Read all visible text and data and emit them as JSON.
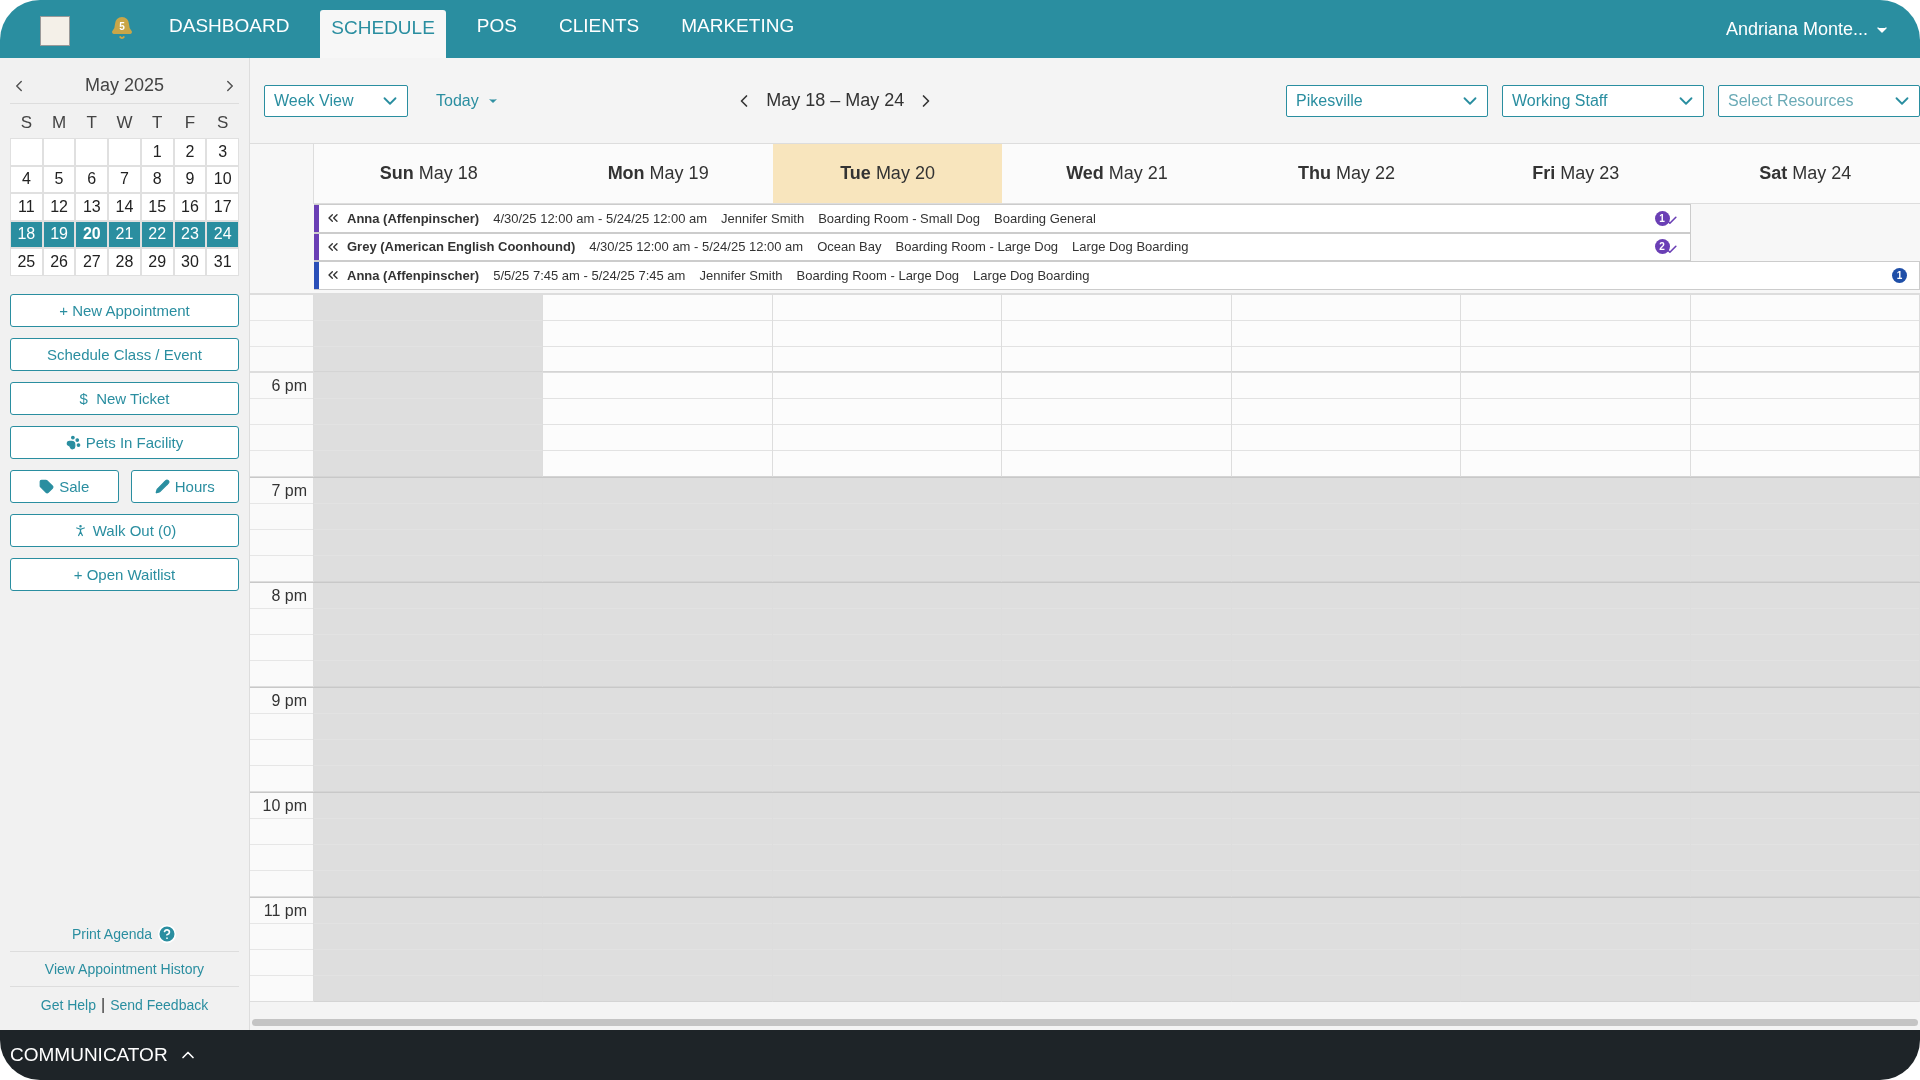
{
  "top_nav": {
    "notification_count": "5",
    "tabs": [
      {
        "label": "DASHBOARD",
        "selected": false
      },
      {
        "label": "SCHEDULE",
        "selected": true
      },
      {
        "label": "POS",
        "selected": false
      },
      {
        "label": "CLIENTS",
        "selected": false
      },
      {
        "label": "MARKETING",
        "selected": false
      }
    ],
    "user": "Andriana Monte..."
  },
  "mini_calendar": {
    "title": "May 2025",
    "weekdays": [
      "S",
      "M",
      "T",
      "W",
      "T",
      "F",
      "S"
    ],
    "weeks": [
      [
        {
          "kind": "blank"
        },
        {
          "kind": "blank"
        },
        {
          "kind": "blank"
        },
        {
          "kind": "blank"
        },
        {
          "kind": "day",
          "label": "1",
          "selected": false,
          "today": false
        },
        {
          "kind": "day",
          "label": "2",
          "selected": false,
          "today": false
        },
        {
          "kind": "day",
          "label": "3",
          "selected": false,
          "today": false
        }
      ],
      [
        {
          "kind": "day",
          "label": "4",
          "selected": false,
          "today": false
        },
        {
          "kind": "day",
          "label": "5",
          "selected": false,
          "today": false
        },
        {
          "kind": "day",
          "label": "6",
          "selected": false,
          "today": false
        },
        {
          "kind": "day",
          "label": "7",
          "selected": false,
          "today": false
        },
        {
          "kind": "day",
          "label": "8",
          "selected": false,
          "today": false
        },
        {
          "kind": "day",
          "label": "9",
          "selected": false,
          "today": false
        },
        {
          "kind": "day",
          "label": "10",
          "selected": false,
          "today": false
        }
      ],
      [
        {
          "kind": "day",
          "label": "11",
          "selected": false,
          "today": false
        },
        {
          "kind": "day",
          "label": "12",
          "selected": false,
          "today": false
        },
        {
          "kind": "day",
          "label": "13",
          "selected": false,
          "today": false
        },
        {
          "kind": "day",
          "label": "14",
          "selected": false,
          "today": false
        },
        {
          "kind": "day",
          "label": "15",
          "selected": false,
          "today": false
        },
        {
          "kind": "day",
          "label": "16",
          "selected": false,
          "today": false
        },
        {
          "kind": "day",
          "label": "17",
          "selected": false,
          "today": false
        }
      ],
      [
        {
          "kind": "day",
          "label": "18",
          "selected": true,
          "today": false
        },
        {
          "kind": "day",
          "label": "19",
          "selected": true,
          "today": false
        },
        {
          "kind": "day",
          "label": "20",
          "selected": true,
          "today": true
        },
        {
          "kind": "day",
          "label": "21",
          "selected": true,
          "today": false
        },
        {
          "kind": "day",
          "label": "22",
          "selected": true,
          "today": false
        },
        {
          "kind": "day",
          "label": "23",
          "selected": true,
          "today": false
        },
        {
          "kind": "day",
          "label": "24",
          "selected": true,
          "today": false
        }
      ],
      [
        {
          "kind": "day",
          "label": "25",
          "selected": false,
          "today": false
        },
        {
          "kind": "day",
          "label": "26",
          "selected": false,
          "today": false
        },
        {
          "kind": "day",
          "label": "27",
          "selected": false,
          "today": false
        },
        {
          "kind": "day",
          "label": "28",
          "selected": false,
          "today": false
        },
        {
          "kind": "day",
          "label": "29",
          "selected": false,
          "today": false
        },
        {
          "kind": "day",
          "label": "30",
          "selected": false,
          "today": false
        },
        {
          "kind": "day",
          "label": "31",
          "selected": false,
          "today": false
        }
      ]
    ]
  },
  "sidebar_buttons": [
    {
      "label": "+ New Appointment",
      "kind": "wide"
    },
    {
      "label": "Schedule Class / Event",
      "kind": "wide"
    },
    {
      "label": "$  New Ticket",
      "kind": "wide"
    },
    {
      "label": "Pets In Facility",
      "kind": "wide"
    },
    {
      "label": "Sale",
      "kind": "half"
    },
    {
      "label": "Hours",
      "kind": "half"
    },
    {
      "label": "Walk Out (0)",
      "kind": "wide"
    },
    {
      "label": "+ Open Waitlist",
      "kind": "wide"
    }
  ],
  "sidebar_links": {
    "print_agenda": "Print Agenda",
    "history": "View Appointment History",
    "help": "Get Help",
    "separator": "|",
    "feedback": "Send Feedback"
  },
  "toolbar": {
    "view": "Week View",
    "today": "Today",
    "range": "May 18 – May 24",
    "location": "Pikesville",
    "staff": "Working Staff",
    "resources_placeholder": "Select Resources"
  },
  "days": [
    {
      "weekday": "Sun",
      "date": "May 18",
      "selected": false,
      "closed": true
    },
    {
      "weekday": "Mon",
      "date": "May 19",
      "selected": false,
      "closed": false
    },
    {
      "weekday": "Tue",
      "date": "May 20",
      "selected": true,
      "closed": false
    },
    {
      "weekday": "Wed",
      "date": "May 21",
      "selected": false,
      "closed": false
    },
    {
      "weekday": "Thu",
      "date": "May 22",
      "selected": false,
      "closed": false
    },
    {
      "weekday": "Fri",
      "date": "May 23",
      "selected": false,
      "closed": false
    },
    {
      "weekday": "Sat",
      "date": "May 24",
      "selected": false,
      "closed": false
    }
  ],
  "events": [
    {
      "pet": "Anna (Affenpinscher)",
      "dates": "4/30/25 12:00 am - 5/24/25 12:00 am",
      "staff": "Jennifer Smith",
      "room": "Boarding Room - Small Dog",
      "service": "Boarding General",
      "badge": "1",
      "confirmed": true,
      "covers_saturday": false,
      "color": "#6a3fb5"
    },
    {
      "pet": "Grey (American English Coonhound)",
      "dates": "4/30/25 12:00 am - 5/24/25 12:00 am",
      "staff": "Ocean Bay",
      "room": "Boarding Room - Large Dog",
      "service": "Large Dog Boarding",
      "badge": "2",
      "confirmed": true,
      "covers_saturday": false,
      "color": "#6a3fb5"
    },
    {
      "pet": "Anna (Affenpinscher)",
      "dates": "5/5/25 7:45 am - 5/24/25 7:45 am",
      "staff": "Jennifer Smith",
      "room": "Boarding Room - Large Dog",
      "service": "Large Dog Boarding",
      "badge": "1",
      "confirmed": false,
      "covers_saturday": true,
      "color": "#2a4fb8"
    }
  ],
  "hours": [
    {
      "after_hours": false
    },
    {
      "label": "6 pm",
      "after_hours": false
    },
    {
      "label": "7 pm",
      "after_hours": true
    },
    {
      "label": "8 pm",
      "after_hours": true
    },
    {
      "label": "9 pm",
      "after_hours": true
    },
    {
      "label": "10 pm",
      "after_hours": true
    },
    {
      "label": "11 pm",
      "after_hours": true
    }
  ],
  "communicator": {
    "label": "COMMUNICATOR"
  }
}
